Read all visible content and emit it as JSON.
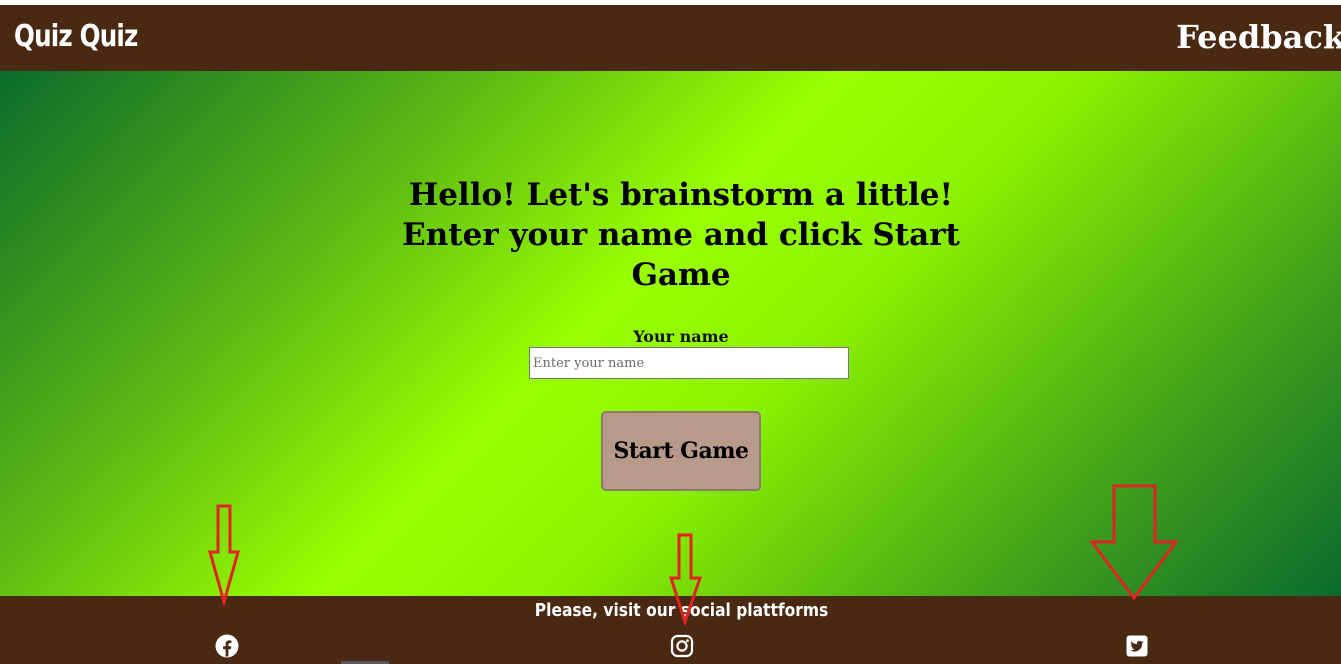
{
  "header": {
    "logo": "Quiz Quiz",
    "feedback_link": "Feedback"
  },
  "main": {
    "heading": "Hello! Let's brainstorm a little! Enter your name and click Start Game",
    "name_label": "Your name",
    "name_input": {
      "value": "",
      "placeholder": "Enter your name"
    },
    "start_button": "Start Game"
  },
  "footer": {
    "text": "Please, visit our social plattforms",
    "socials": [
      "facebook-icon",
      "instagram-icon",
      "twitter-icon"
    ]
  },
  "annotations": {
    "arrow_color": "#e02424"
  },
  "colors": {
    "header_bg": "#4a2912",
    "button_bg": "#b89a8a",
    "gradient_light": "#9aff00",
    "gradient_dark": "#0b6b2b"
  }
}
